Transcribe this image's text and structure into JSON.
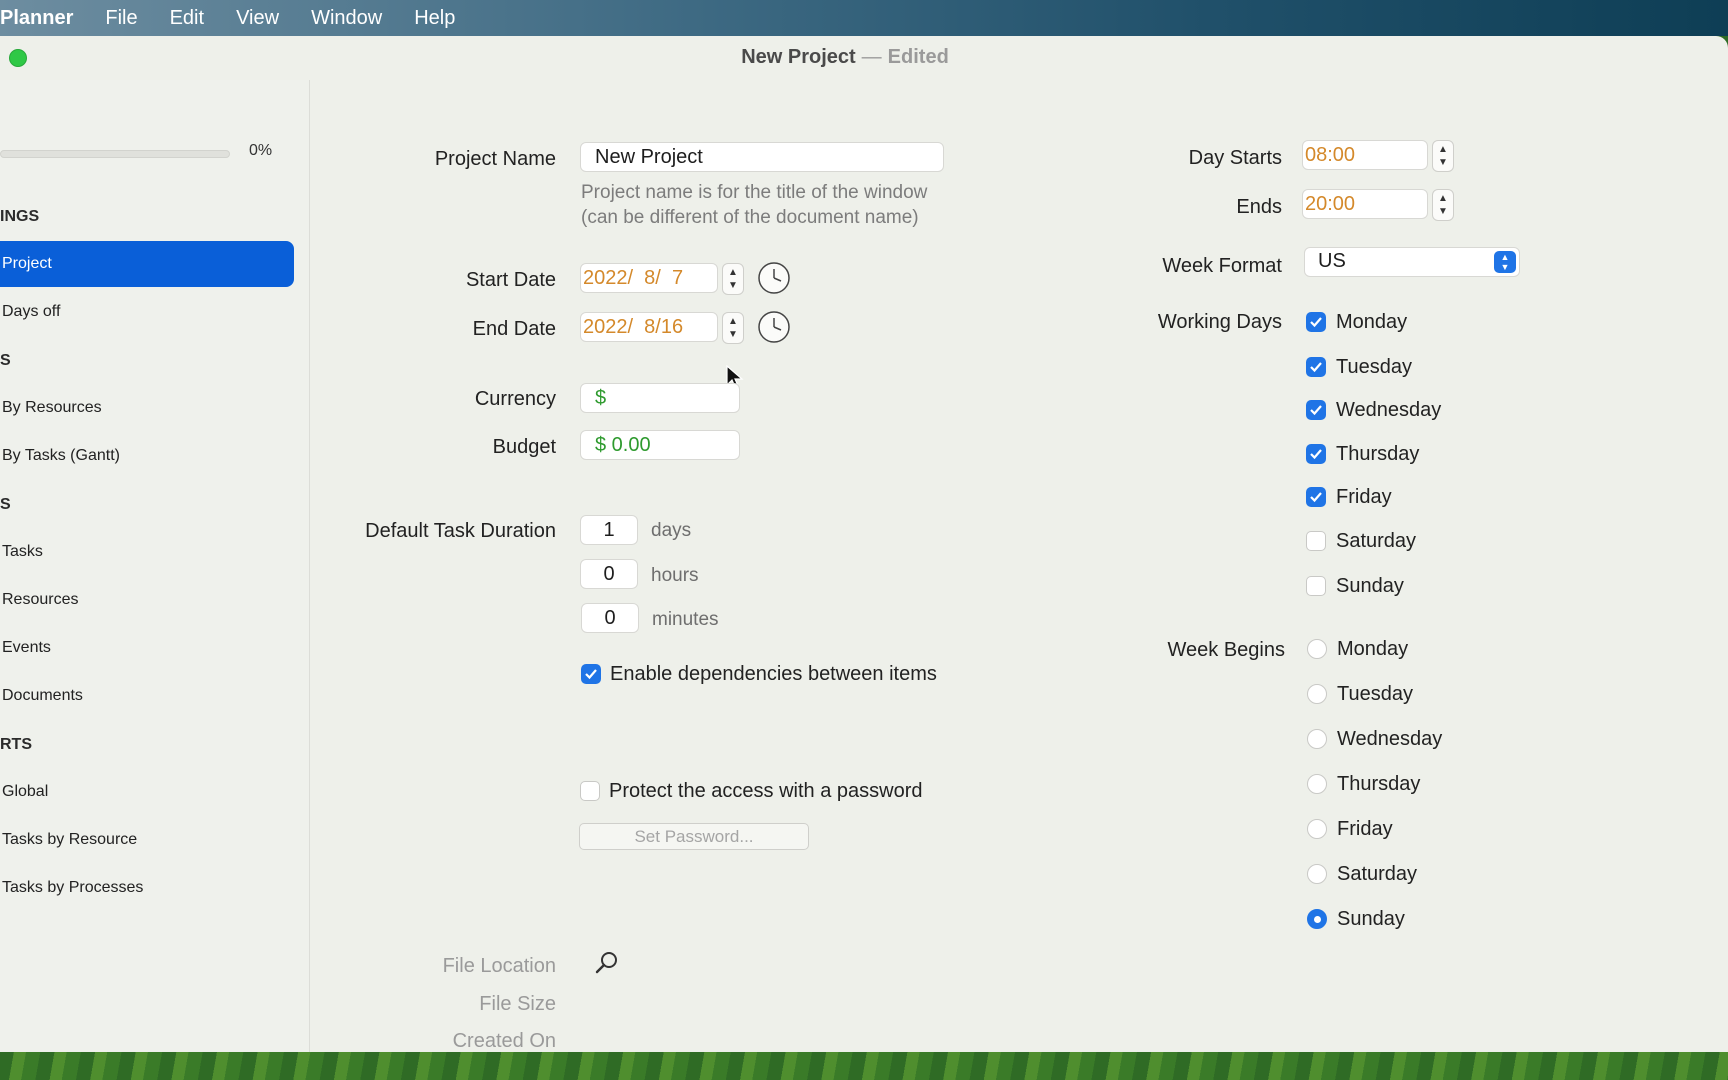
{
  "menubar": {
    "app_name": "Planner",
    "items": [
      "File",
      "Edit",
      "View",
      "Window",
      "Help"
    ]
  },
  "window": {
    "title": "New Project",
    "separator": "—",
    "status": "Edited"
  },
  "sidebar": {
    "progress": {
      "value": 0,
      "label": "0%"
    },
    "sections": [
      {
        "title": "INGS",
        "items": [
          {
            "label": "Project",
            "selected": true
          },
          {
            "label": "Days off"
          }
        ]
      },
      {
        "title": "S",
        "items": [
          {
            "label": "By Resources"
          },
          {
            "label": "By Tasks (Gantt)"
          }
        ]
      },
      {
        "title": "S",
        "items": [
          {
            "label": "Tasks"
          },
          {
            "label": "Resources"
          },
          {
            "label": "Events"
          },
          {
            "label": "Documents"
          }
        ]
      },
      {
        "title": "RTS",
        "items": [
          {
            "label": "Global"
          },
          {
            "label": "Tasks by Resource"
          },
          {
            "label": "Tasks by Processes"
          }
        ]
      }
    ]
  },
  "form": {
    "project_name": {
      "label": "Project Name",
      "value": "New Project"
    },
    "hint_line1": "Project name is for the title of the window",
    "hint_line2": "(can be different of the document name)",
    "start_date": {
      "label": "Start Date",
      "value": "2022/  8/  7"
    },
    "end_date": {
      "label": "End Date",
      "value": "2022/  8/16"
    },
    "currency": {
      "label": "Currency",
      "value": "$"
    },
    "budget": {
      "label": "Budget",
      "value": "$ 0.00"
    },
    "duration": {
      "label": "Default Task Duration",
      "days": "1",
      "days_unit": "days",
      "hours": "0",
      "hours_unit": "hours",
      "minutes": "0",
      "minutes_unit": "minutes"
    },
    "dependencies": {
      "label": "Enable dependencies between items",
      "checked": true
    },
    "password": {
      "label": "Protect the access with a password",
      "checked": false,
      "button": "Set Password..."
    },
    "file_location_label": "File Location",
    "file_size_label": "File Size",
    "created_on_label": "Created On"
  },
  "right": {
    "day_starts": {
      "label": "Day Starts",
      "value": "08:00"
    },
    "ends": {
      "label": "Ends",
      "value": "20:00"
    },
    "week_format": {
      "label": "Week Format",
      "value": "US"
    },
    "working_days": {
      "label": "Working Days",
      "days": [
        {
          "label": "Monday",
          "checked": true
        },
        {
          "label": "Tuesday",
          "checked": true
        },
        {
          "label": "Wednesday",
          "checked": true
        },
        {
          "label": "Thursday",
          "checked": true
        },
        {
          "label": "Friday",
          "checked": true
        },
        {
          "label": "Saturday",
          "checked": false
        },
        {
          "label": "Sunday",
          "checked": false
        }
      ]
    },
    "week_begins": {
      "label": "Week Begins",
      "days": [
        {
          "label": "Monday",
          "selected": false
        },
        {
          "label": "Tuesday",
          "selected": false
        },
        {
          "label": "Wednesday",
          "selected": false
        },
        {
          "label": "Thursday",
          "selected": false
        },
        {
          "label": "Friday",
          "selected": false
        },
        {
          "label": "Saturday",
          "selected": false
        },
        {
          "label": "Sunday",
          "selected": true
        }
      ]
    }
  },
  "colors": {
    "accent": "#1f74e6",
    "selection": "#0a5fd8",
    "date_text": "#d4892b",
    "money_text": "#2e9a2e"
  }
}
